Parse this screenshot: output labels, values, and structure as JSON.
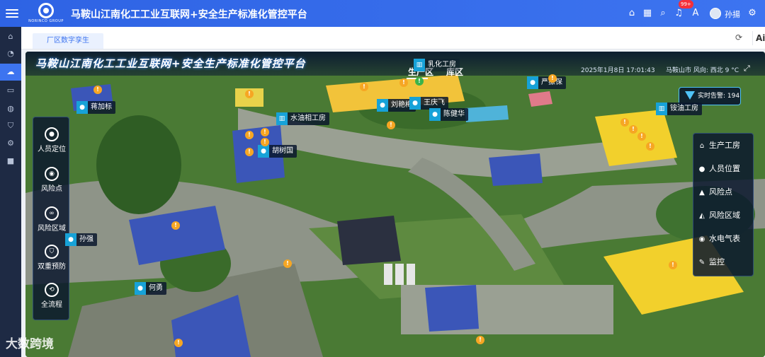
{
  "topbar": {
    "logo_text": "NORINCO GROUP",
    "title": "马鞍山江南化工工业互联网+安全生产标准化管控平台",
    "notification_count": "99+",
    "username": "孙揚",
    "icons": [
      "home-icon",
      "grid-icon",
      "search-icon",
      "bell-icon",
      "translate-icon",
      "gear-icon"
    ]
  },
  "sidebar": {
    "items": [
      "home-icon",
      "dashboard-icon",
      "cloud-icon",
      "monitor-icon",
      "globe-icon",
      "shield-icon",
      "settings-icon",
      "video-icon"
    ]
  },
  "tabs": {
    "active_tab": "厂区数字孪生",
    "ai_label": "Ai"
  },
  "map": {
    "title": "马鞍山江南化工工业互联网+安全生产标准化管控平台",
    "zone_tabs": [
      "生产区",
      "库区"
    ],
    "datetime": "2025年1月8日 17:01:43",
    "weather": "马鞍山市 风向: 西北 9 °C",
    "alarm_label": "实时告警: 194",
    "left_menu": [
      {
        "label": "人员定位",
        "icon": "person-location-icon"
      },
      {
        "label": "风险点",
        "icon": "risk-point-icon"
      },
      {
        "label": "风险区域",
        "icon": "risk-area-icon"
      },
      {
        "label": "双重预防",
        "icon": "dual-prevention-icon"
      },
      {
        "label": "全流程",
        "icon": "full-process-icon"
      }
    ],
    "right_menu": [
      {
        "label": "生产工房",
        "icon": "factory-icon"
      },
      {
        "label": "人员位置",
        "icon": "person-icon"
      },
      {
        "label": "风险点",
        "icon": "warning-icon"
      },
      {
        "label": "风险区域",
        "icon": "area-icon"
      },
      {
        "label": "水电气表",
        "icon": "meter-icon"
      },
      {
        "label": "监控",
        "icon": "camera-icon"
      }
    ],
    "people": [
      "蒋加标",
      "刘艳梅",
      "王庆飞",
      "陈健华",
      "胡树国",
      "孙强",
      "何勇",
      "严振保"
    ],
    "facilities": [
      "水油相工房",
      "铵油工房",
      "乳化工房"
    ],
    "watermark": "大数跨境"
  },
  "colors": {
    "topbar": "#3d74f0",
    "sidebar": "#1e2a44",
    "risk": "#f6a623",
    "label_accent": "#17a2d8",
    "building_yellow": "#f2d02c",
    "building_blue": "#3b56b8"
  }
}
